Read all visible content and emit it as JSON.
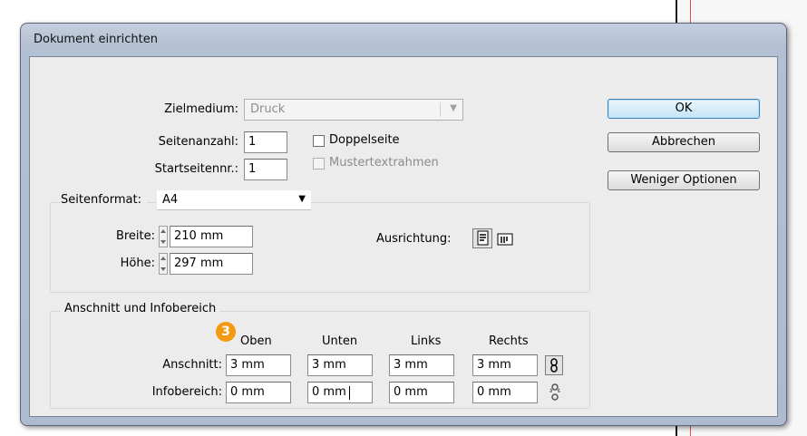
{
  "dialog": {
    "title": "Dokument einrichten"
  },
  "form": {
    "zielmedium_label": "Zielmedium:",
    "zielmedium_value": "Druck",
    "seitenanzahl_label": "Seitenanzahl:",
    "seitenanzahl_value": "1",
    "startseitennr_label": "Startseitennr.:",
    "startseitennr_value": "1",
    "doppelseite_label": "Doppelseite",
    "doppelseite_checked": false,
    "mustertextrahmen_label": "Mustertextrahmen",
    "mustertextrahmen_checked": false
  },
  "buttons": {
    "ok": "OK",
    "cancel": "Abbrechen",
    "fewer_options": "Weniger Optionen"
  },
  "seitenformat": {
    "label": "Seitenformat:",
    "value": "A4",
    "breite_label": "Breite:",
    "breite_value": "210 mm",
    "hoehe_label": "Höhe:",
    "hoehe_value": "297 mm",
    "ausrichtung_label": "Ausrichtung:"
  },
  "anschnitt": {
    "group_label": "Anschnitt und Infobereich",
    "step_badge": "3",
    "columns": [
      "Oben",
      "Unten",
      "Links",
      "Rechts"
    ],
    "anschnitt_label": "Anschnitt:",
    "anschnitt_values": [
      "3 mm",
      "3 mm",
      "3 mm",
      "3 mm"
    ],
    "infobereich_label": "Infobereich:",
    "infobereich_values": [
      "0 mm",
      "0 mm",
      "0 mm",
      "0 mm"
    ]
  },
  "icons": {
    "portrait": "portrait-orientation-icon",
    "landscape": "landscape-orientation-icon",
    "chain": "chain-link-icon",
    "chain_broken": "chain-broken-icon"
  },
  "colors": {
    "badge": "#f39a12",
    "default_button": "#c5e4f7",
    "window_frame": "#b3bfd2"
  }
}
